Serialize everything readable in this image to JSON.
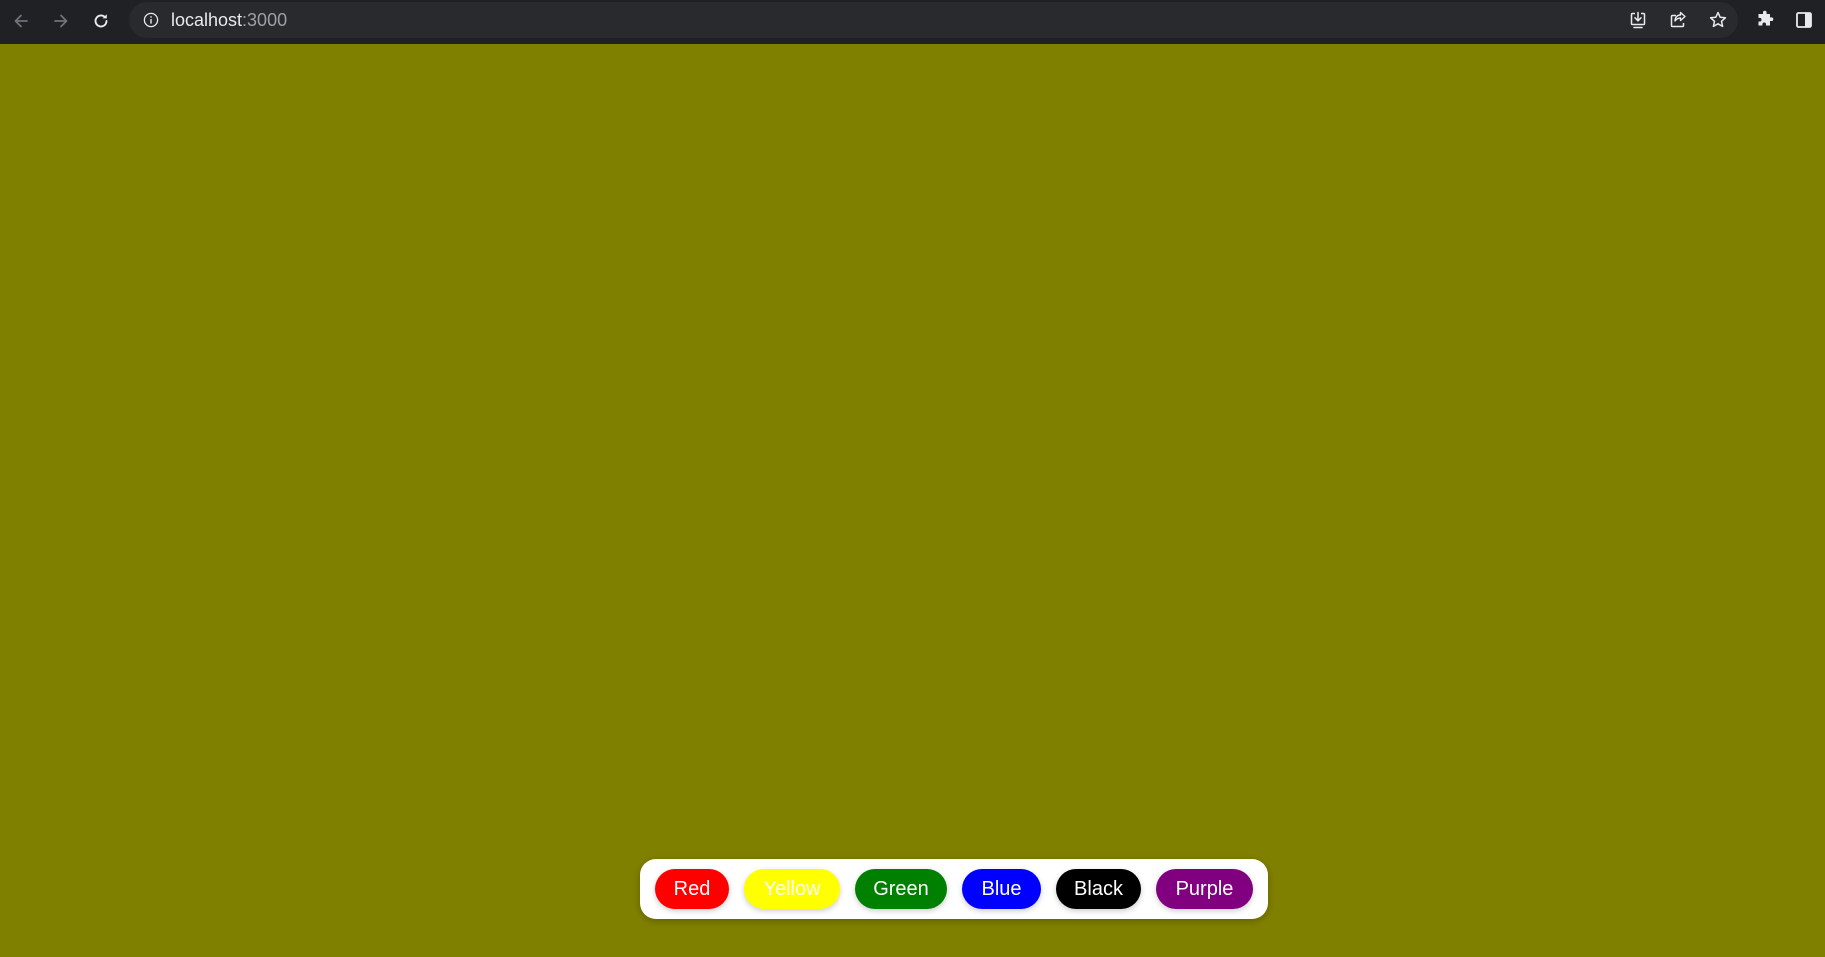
{
  "browser": {
    "url_host": "localhost",
    "url_port": ":3000"
  },
  "page": {
    "background_color": "#808000"
  },
  "palette": {
    "buttons": [
      {
        "label": "Red",
        "color": "#ff0000",
        "icon": ""
      },
      {
        "label": "Yellow",
        "color": "#ffff00",
        "icon": ""
      },
      {
        "label": "Green",
        "color": "#008000",
        "icon": ""
      },
      {
        "label": "Blue",
        "color": "#0000ff",
        "icon": ""
      },
      {
        "label": "Black",
        "color": "#000000",
        "icon": ""
      },
      {
        "label": "Purple",
        "color": "#800080",
        "icon": ""
      }
    ]
  },
  "icons": {
    "back": "arrow-left-icon",
    "forward": "arrow-right-icon",
    "reload": "reload-icon",
    "site_info": "info-icon",
    "install": "install-app-icon",
    "share": "share-icon",
    "bookmark": "star-icon",
    "extensions": "puzzle-icon",
    "side_panel": "side-panel-icon"
  }
}
